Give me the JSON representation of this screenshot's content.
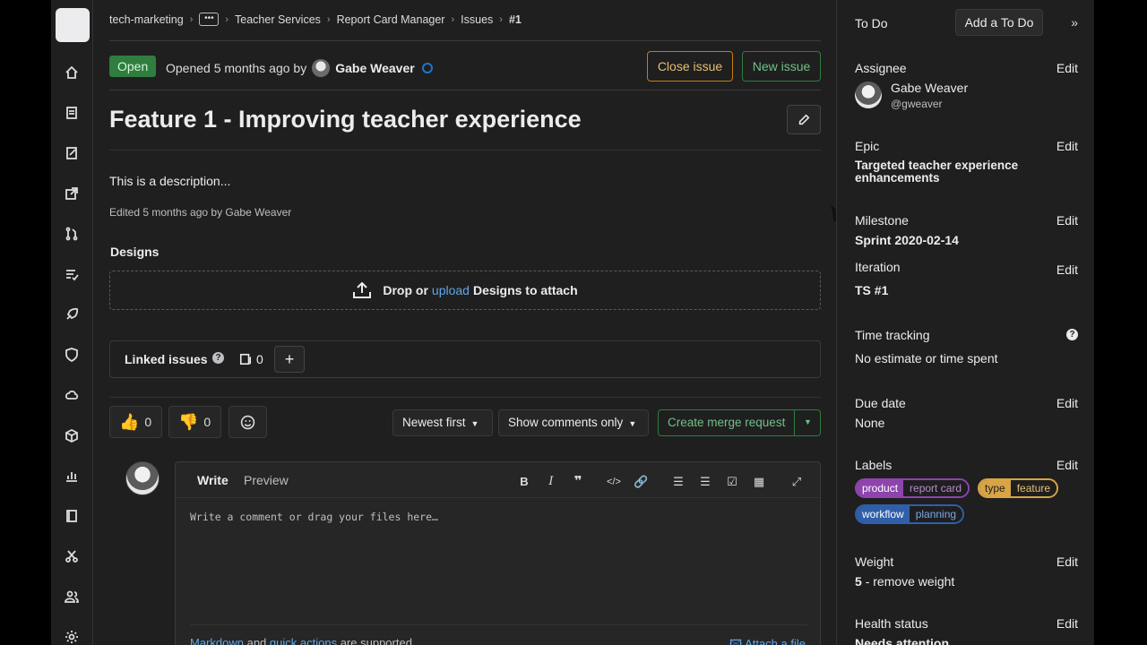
{
  "breadcrumb": {
    "group": "tech-marketing",
    "more": "•••",
    "items": [
      "Teacher Services",
      "Report Card Manager",
      "Issues"
    ],
    "current": "#1"
  },
  "issue": {
    "status": "Open",
    "opened_prefix": "Opened 5 months ago by",
    "author": "Gabe Weaver",
    "close_label": "Close issue",
    "new_label": "New issue",
    "title": "Feature 1 - Improving teacher experience",
    "description": "This is a description...",
    "edited": "Edited 5 months ago by Gabe Weaver"
  },
  "designs": {
    "heading": "Designs",
    "drop": "Drop or",
    "upload": "upload",
    "suffix": "Designs to attach"
  },
  "linked": {
    "label": "Linked issues",
    "count": "0",
    "help": "?",
    "add": "+"
  },
  "awards": {
    "thumbsup_count": "0",
    "thumbsdown_count": "0"
  },
  "controls": {
    "sort": "Newest first",
    "filter": "Show comments only",
    "merge_request": "Create merge request"
  },
  "editor": {
    "tab_write": "Write",
    "tab_preview": "Preview",
    "placeholder": "Write a comment or drag your files here…",
    "markdown": "Markdown",
    "and": "and",
    "quick_actions": "quick actions",
    "supported": "are supported",
    "attach": "Attach a file"
  },
  "sidebar": {
    "todo_label": "To Do",
    "add_todo": "Add a To Do",
    "edit": "Edit",
    "assignee": {
      "label": "Assignee",
      "name": "Gabe Weaver",
      "handle": "@gweaver"
    },
    "epic": {
      "label": "Epic",
      "value": "Targeted teacher experience enhancements"
    },
    "milestone": {
      "label": "Milestone",
      "value": "Sprint 2020-02-14"
    },
    "iteration": {
      "label": "Iteration",
      "value": "TS #1"
    },
    "time_tracking": {
      "label": "Time tracking",
      "value": "No estimate or time spent"
    },
    "due_date": {
      "label": "Due date",
      "value": "None"
    },
    "labels": {
      "label": "Labels",
      "items": [
        {
          "key": "product",
          "value": "report card",
          "color": "#8e44ad",
          "text": "#b98ad0"
        },
        {
          "key": "type",
          "value": "feature",
          "color": "#d8a445",
          "text": "#e9be74"
        },
        {
          "key": "workflow",
          "value": "planning",
          "color": "#2f5fa8",
          "text": "#7aa7e8"
        }
      ]
    },
    "weight": {
      "label": "Weight",
      "value": "5",
      "remove": "- remove weight"
    },
    "health": {
      "label": "Health status",
      "value": "Needs attention"
    }
  },
  "colors": {
    "accent_blue": "#63a6e9",
    "open_green": "#2f7d3f",
    "warning_orange": "#c17d10"
  }
}
